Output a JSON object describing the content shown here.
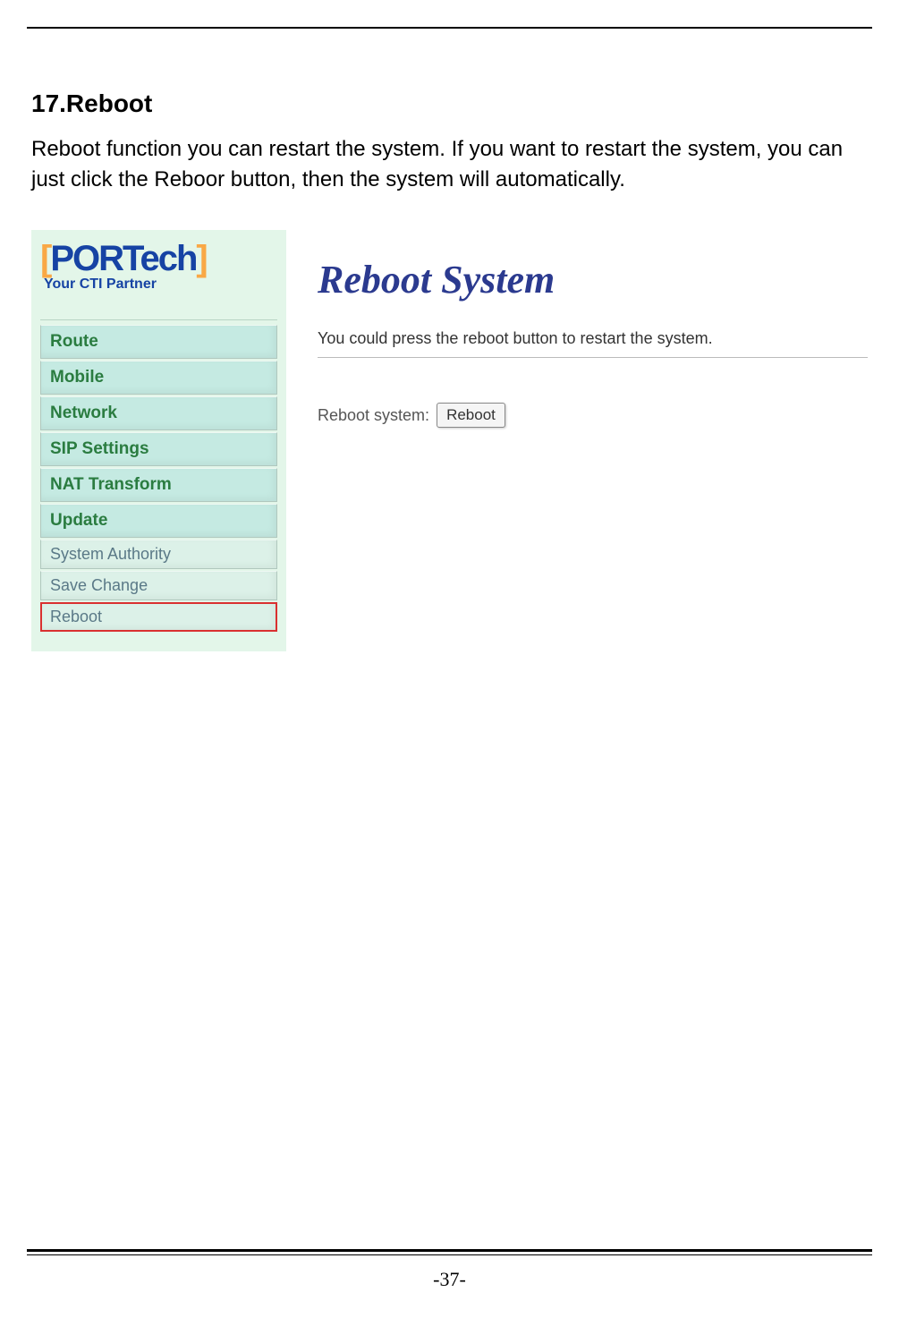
{
  "heading": "17.Reboot",
  "description": "Reboot function you can restart the system. If you want to restart the system, you can just click the Reboor button, then the system will automatically.",
  "logo": {
    "main": "PORTech",
    "tagline": "Your CTI Partner"
  },
  "sidebar": {
    "items": [
      {
        "label": "Route",
        "type": "main"
      },
      {
        "label": "Mobile",
        "type": "main"
      },
      {
        "label": "Network",
        "type": "main"
      },
      {
        "label": "SIP Settings",
        "type": "main"
      },
      {
        "label": "NAT Transform",
        "type": "main"
      },
      {
        "label": "Update",
        "type": "main"
      },
      {
        "label": "System Authority",
        "type": "sub"
      },
      {
        "label": "Save Change",
        "type": "sub"
      },
      {
        "label": "Reboot",
        "type": "sub",
        "highlighted": true
      }
    ]
  },
  "main": {
    "title": "Reboot System",
    "subtext": "You could press the reboot button to restart the system.",
    "reboot_label": "Reboot system:",
    "reboot_button": "Reboot"
  },
  "page_number": "-37-"
}
